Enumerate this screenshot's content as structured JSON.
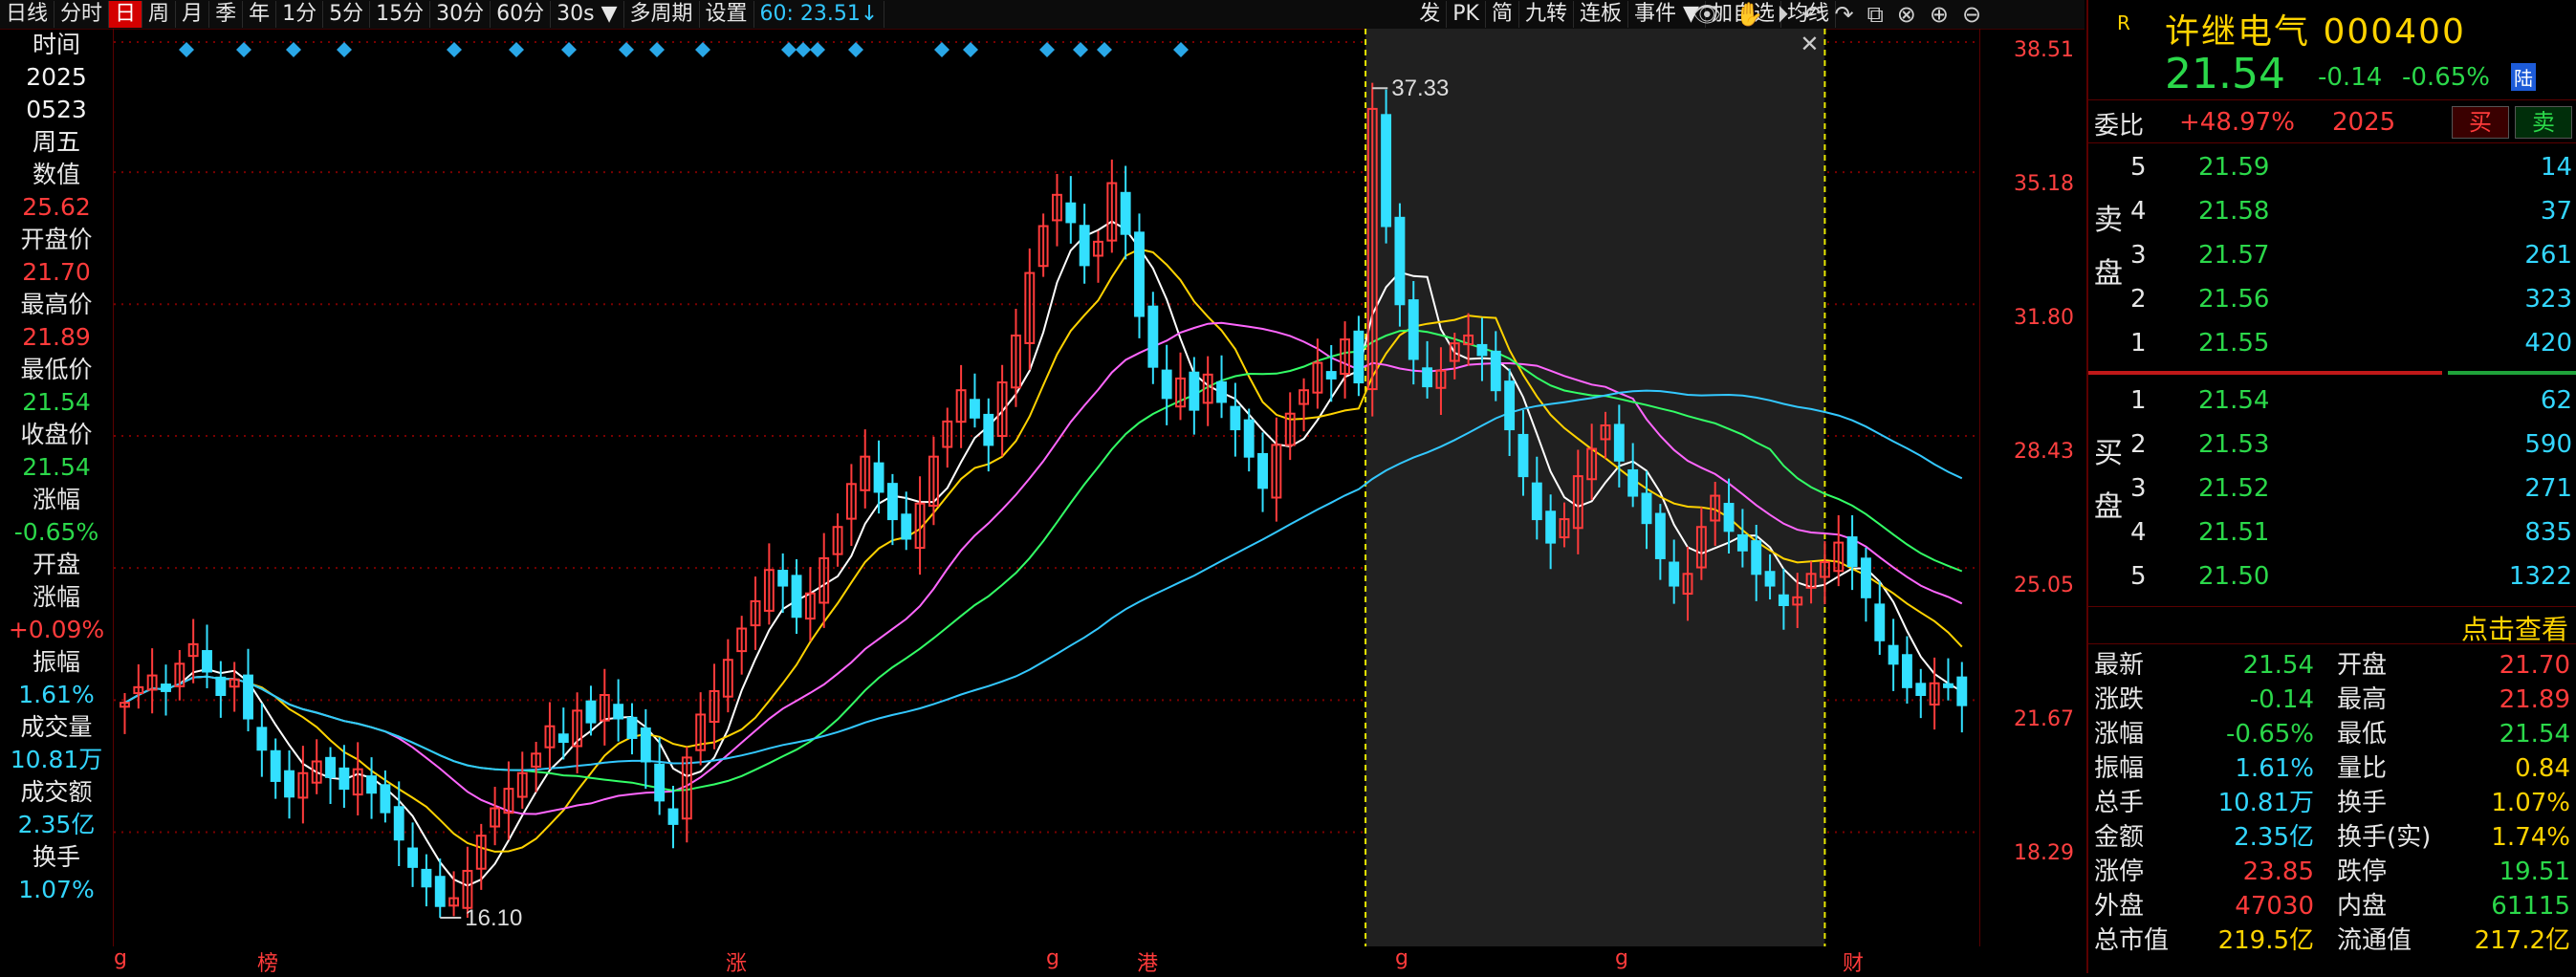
{
  "toolbar": {
    "items": [
      "日线",
      "分时",
      "日",
      "周",
      "月",
      "季",
      "年",
      "1分",
      "5分",
      "15分",
      "30分",
      "60分",
      "30s",
      "多周期",
      "设置"
    ],
    "ma_text": "60: 23.51↓",
    "right_items": [
      "发",
      "PK",
      "简",
      "九转",
      "连板",
      "事件",
      "加自选",
      "均线"
    ],
    "icons": [
      "eye-icon",
      "hand-icon",
      "play-icon",
      "undo-icon",
      "redo-icon",
      "copy-icon",
      "cross-icon",
      "zoom-in-icon",
      "zoom-out-icon"
    ]
  },
  "info": {
    "time_label": "时间",
    "year": "2025",
    "date": "0523",
    "weekday": "周五",
    "value_label": "数值",
    "value": "25.62",
    "open_label": "开盘价",
    "open": "21.70",
    "high_label": "最高价",
    "high": "21.89",
    "low_label": "最低价",
    "low": "21.54",
    "close_label": "收盘价",
    "close": "21.54",
    "chg_label": "涨幅",
    "chg": "-0.65%",
    "openchg_label1": "开盘",
    "openchg_label2": "涨幅",
    "openchg": "+0.09%",
    "amp_label": "振幅",
    "amp": "1.61%",
    "vol_label": "成交量",
    "vol": "10.81万",
    "amt_label": "成交额",
    "amt": "2.35亿",
    "turn_label": "换手",
    "turn": "1.07%"
  },
  "axis": {
    "ticks": [
      "38.51",
      "35.18",
      "31.80",
      "28.43",
      "25.05",
      "21.67",
      "18.29"
    ]
  },
  "chart_labels": {
    "high": "37.33",
    "low": "16.10",
    "close_x": "✕"
  },
  "bottom_marks": [
    "g",
    "榜",
    "涨",
    "g",
    "港",
    "g",
    "g",
    "财"
  ],
  "chart_data": {
    "type": "candlestick",
    "ylim": [
      16.1,
      38.51
    ],
    "closes": [
      21.6,
      22.0,
      22.3,
      21.9,
      22.6,
      23.1,
      22.4,
      21.8,
      22.2,
      21.2,
      20.4,
      19.6,
      19.2,
      19.8,
      20.1,
      19.7,
      19.4,
      19.9,
      19.3,
      18.8,
      18.1,
      17.4,
      16.9,
      16.4,
      16.6,
      17.3,
      18.2,
      18.9,
      19.4,
      19.8,
      20.3,
      21.0,
      20.6,
      21.4,
      21.1,
      21.8,
      21.2,
      20.7,
      20.1,
      19.1,
      18.5,
      20.2,
      21.3,
      21.9,
      22.7,
      23.5,
      24.2,
      25.0,
      24.6,
      23.8,
      24.4,
      25.3,
      26.1,
      27.2,
      27.9,
      27.0,
      26.3,
      25.8,
      26.7,
      27.9,
      28.8,
      29.6,
      28.9,
      28.2,
      29.8,
      31.0,
      32.6,
      33.8,
      34.6,
      33.9,
      32.8,
      33.4,
      34.9,
      33.6,
      31.5,
      30.2,
      29.4,
      29.9,
      29.1,
      30.0,
      29.3,
      28.6,
      27.9,
      27.1,
      28.2,
      29.0,
      29.6,
      30.3,
      29.9,
      30.9,
      29.8,
      36.8,
      33.8,
      31.8,
      30.4,
      29.7,
      30.1,
      30.8,
      31.0,
      30.5,
      29.6,
      28.6,
      27.4,
      26.3,
      25.7,
      26.3,
      27.4,
      28.1,
      28.7,
      27.8,
      26.9,
      26.2,
      25.3,
      24.6,
      24.9,
      26.1,
      26.9,
      26.0,
      25.5,
      24.9,
      24.6,
      24.1,
      24.3,
      24.9,
      25.2,
      25.7,
      25.1,
      24.3,
      23.2,
      22.6,
      22.0,
      21.8,
      22.1,
      22.0,
      21.54
    ]
  },
  "quote": {
    "badge": "R",
    "name": "许继电气 000400",
    "price": "21.54",
    "change": "-0.14",
    "change_pct": "-0.65%",
    "market_tag": "陆",
    "weibi_label": "委比",
    "weibi": "+48.97%",
    "weicha": "2025",
    "buy_label": "买",
    "sell_label": "卖",
    "sell_side_label": [
      "卖",
      "盘"
    ],
    "buy_side_label": [
      "买",
      "盘"
    ],
    "asks": [
      {
        "i": "5",
        "p": "21.59",
        "v": "14"
      },
      {
        "i": "4",
        "p": "21.58",
        "v": "37"
      },
      {
        "i": "3",
        "p": "21.57",
        "v": "261"
      },
      {
        "i": "2",
        "p": "21.56",
        "v": "323"
      },
      {
        "i": "1",
        "p": "21.55",
        "v": "420"
      }
    ],
    "bids": [
      {
        "i": "1",
        "p": "21.54",
        "v": "62"
      },
      {
        "i": "2",
        "p": "21.53",
        "v": "590"
      },
      {
        "i": "3",
        "p": "21.52",
        "v": "271"
      },
      {
        "i": "4",
        "p": "21.51",
        "v": "835"
      },
      {
        "i": "5",
        "p": "21.50",
        "v": "1322"
      }
    ],
    "click_text": "点击查看",
    "stats": [
      {
        "l": "最新",
        "v": "21.54",
        "c": "green",
        "l2": "开盘",
        "v2": "21.70",
        "c2": "red"
      },
      {
        "l": "涨跌",
        "v": "-0.14",
        "c": "green",
        "l2": "最高",
        "v2": "21.89",
        "c2": "red"
      },
      {
        "l": "涨幅",
        "v": "-0.65%",
        "c": "green",
        "l2": "最低",
        "v2": "21.54",
        "c2": "green"
      },
      {
        "l": "振幅",
        "v": "1.61%",
        "c": "cyan",
        "l2": "量比",
        "v2": "0.84",
        "c2": "yellow"
      },
      {
        "l": "总手",
        "v": "10.81万",
        "c": "cyan",
        "l2": "换手",
        "v2": "1.07%",
        "c2": "yellow"
      },
      {
        "l": "金额",
        "v": "2.35亿",
        "c": "cyan",
        "l2": "换手(实)",
        "v2": "1.74%",
        "c2": "yellow"
      },
      {
        "l": "涨停",
        "v": "23.85",
        "c": "red",
        "l2": "跌停",
        "v2": "19.51",
        "c2": "green"
      },
      {
        "l": "外盘",
        "v": "47030",
        "c": "red",
        "l2": "内盘",
        "v2": "61115",
        "c2": "green"
      },
      {
        "l": "总市值",
        "v": "219.5亿",
        "c": "yellow",
        "l2": "流通值",
        "v2": "217.2亿",
        "c2": "yellow"
      }
    ]
  },
  "colors": {
    "up": "#ff3b3b",
    "down": "#33e0ff",
    "ma5": "#ffffff",
    "ma10": "#ffd300",
    "ma20": "#ff66ff",
    "ma30": "#33ff66",
    "ma60": "#33c8ff"
  }
}
